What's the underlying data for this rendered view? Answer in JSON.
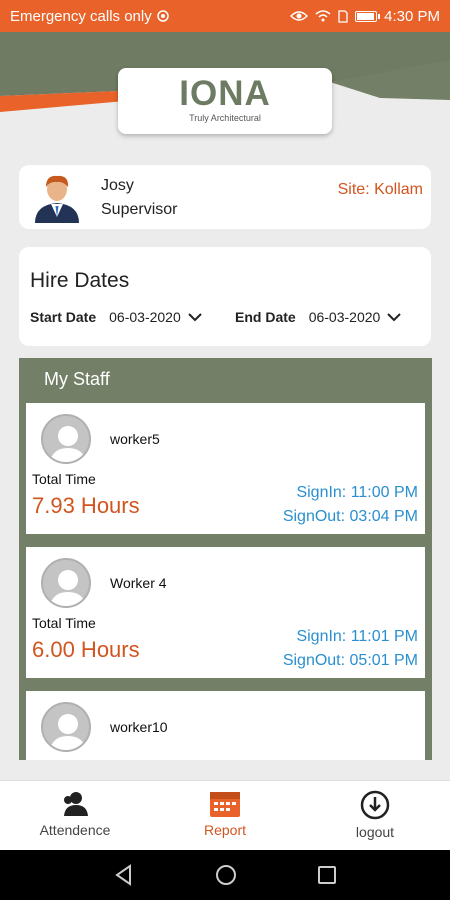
{
  "status_bar": {
    "carrier": "Emergency calls only",
    "time": "4:30 PM",
    "battery_level": 0.85
  },
  "logo": {
    "brand": "IONA",
    "tagline": "Truly Architectural"
  },
  "profile": {
    "name": "Josy",
    "role": "Supervisor",
    "site": "Site: Kollam"
  },
  "hire_dates": {
    "title": "Hire Dates",
    "start_label": "Start Date",
    "start_value": "06-03-2020",
    "end_label": "End Date",
    "end_value": "06-03-2020"
  },
  "staff": {
    "title": "My Staff",
    "items": [
      {
        "name": "worker5",
        "total_label": "Total Time",
        "hours": "7.93 Hours",
        "sign_in": "SignIn: 11:00 PM",
        "sign_out": "SignOut: 03:04 PM"
      },
      {
        "name": "Worker 4",
        "total_label": "Total Time",
        "hours": "6.00 Hours",
        "sign_in": "SignIn: 11:01 PM",
        "sign_out": "SignOut: 05:01 PM"
      },
      {
        "name": "worker10"
      }
    ]
  },
  "bottom_nav": {
    "attendance": "Attendence",
    "report": "Report",
    "logout": "logout"
  },
  "colors": {
    "accent": "#e8622a",
    "olive": "#737f66",
    "link": "#2a8fd0"
  },
  "icons": {
    "status": [
      "eye-icon",
      "wifi-icon",
      "sim-icon",
      "battery-icon"
    ],
    "nav": [
      "attendance-icon",
      "calendar-icon",
      "logout-icon"
    ],
    "system": [
      "back-icon",
      "home-icon",
      "recents-icon"
    ]
  }
}
